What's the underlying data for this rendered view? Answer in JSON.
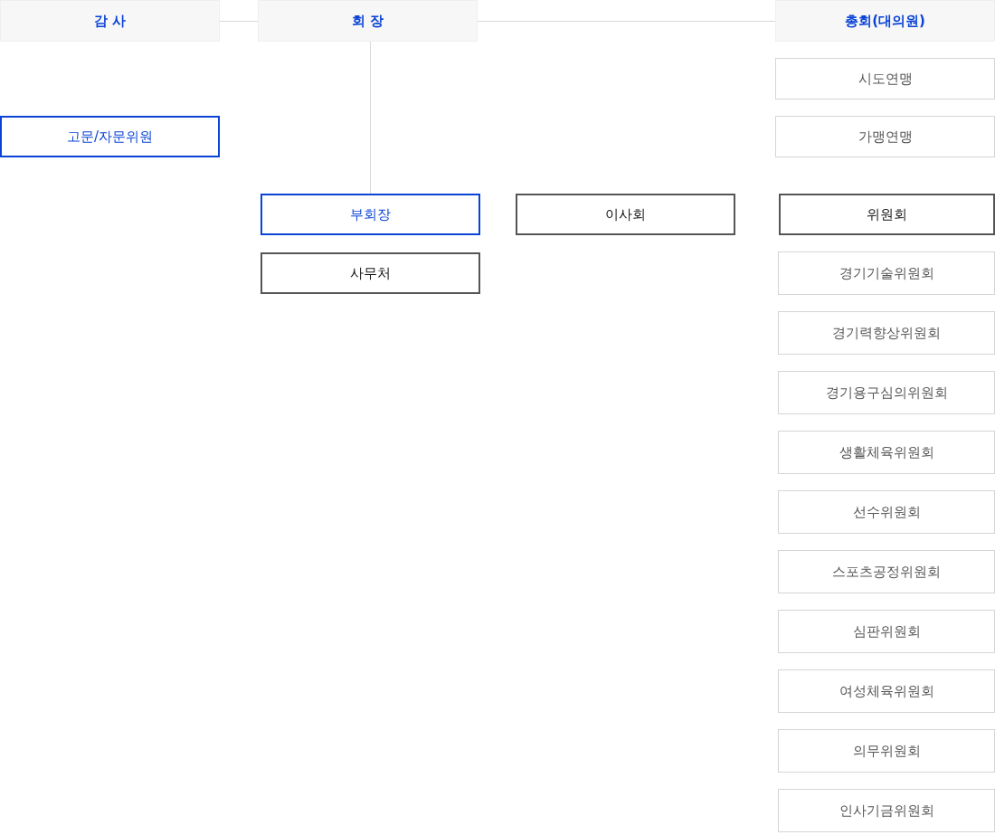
{
  "top": [
    {
      "label": "감 사",
      "kind": "header"
    },
    {
      "label": "회 장",
      "kind": "header"
    },
    {
      "label": "총회(대의원)",
      "kind": "header"
    }
  ],
  "advisory": {
    "label": "고문/자문위원",
    "kind": "primary"
  },
  "president_units": [
    {
      "label": "부회장",
      "kind": "primary"
    },
    {
      "label": "사무처",
      "kind": "dark"
    }
  ],
  "board": {
    "label": "이사회",
    "kind": "dark"
  },
  "federations": [
    {
      "label": "시도연맹",
      "kind": "plain"
    },
    {
      "label": "가맹연맹",
      "kind": "plain"
    }
  ],
  "committee_head": {
    "label": "위원회",
    "kind": "dark"
  },
  "committees": [
    {
      "label": "경기기술위원회",
      "kind": "plain"
    },
    {
      "label": "경기력향상위원회",
      "kind": "plain"
    },
    {
      "label": "경기용구심의위원회",
      "kind": "plain"
    },
    {
      "label": "생활체육위원회",
      "kind": "plain"
    },
    {
      "label": "선수위원회",
      "kind": "plain"
    },
    {
      "label": "스포츠공정위원회",
      "kind": "plain"
    },
    {
      "label": "심판위원회",
      "kind": "plain"
    },
    {
      "label": "여성체육위원회",
      "kind": "plain"
    },
    {
      "label": "의무위원회",
      "kind": "plain"
    },
    {
      "label": "인사기금위원회",
      "kind": "plain"
    }
  ]
}
